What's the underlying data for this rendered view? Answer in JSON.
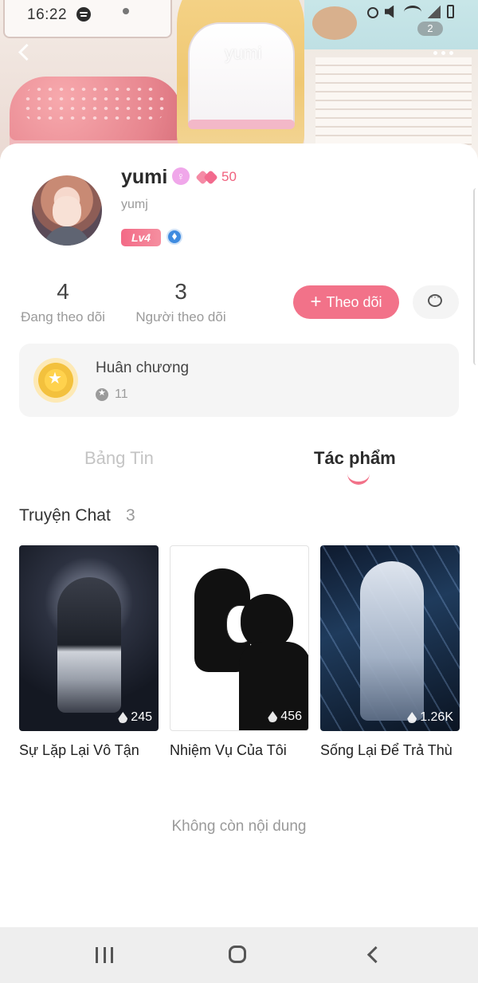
{
  "status_bar": {
    "time": "16:22",
    "notification_badge": "2"
  },
  "header": {
    "watermark": "yumi"
  },
  "profile": {
    "name": "yumi",
    "handle": "yumj",
    "likes": "50",
    "level": "Lv4",
    "following_count": "4",
    "following_label": "Đang theo dõi",
    "followers_count": "3",
    "followers_label": "Người theo dõi",
    "follow_button": "Theo dõi"
  },
  "medals": {
    "title": "Huân chương",
    "count": "11"
  },
  "tabs": {
    "news": "Bảng Tin",
    "works": "Tác phẩm",
    "active": "works"
  },
  "section": {
    "title": "Truyện Chat",
    "count": "3"
  },
  "stories": [
    {
      "title": "Sự Lặp Lại Vô Tận",
      "views": "245"
    },
    {
      "title": "Nhiệm Vụ Của Tôi",
      "views": "456"
    },
    {
      "title": "Sống Lại Để Trả Thù",
      "views": "1.26K"
    }
  ],
  "footer_text": "Không còn nội dung",
  "colors": {
    "accent": "#f27289",
    "muted_text": "#9a9a9a",
    "card_bg": "#f5f5f5"
  },
  "icons": {
    "status": [
      "spotify-icon",
      "alarm-icon",
      "mute-icon",
      "wifi-icon",
      "signal-icon",
      "battery-icon"
    ],
    "header": [
      "back-icon",
      "more-icon"
    ],
    "profile": [
      "female-gender-icon",
      "hearts-icon",
      "shield-icon",
      "chat-icon",
      "plus-icon"
    ],
    "nav": [
      "recent-apps-icon",
      "home-icon",
      "back-icon"
    ]
  }
}
